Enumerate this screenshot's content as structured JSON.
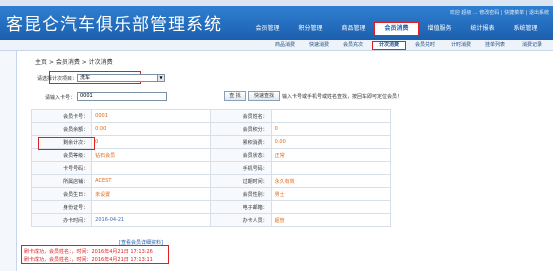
{
  "header": {
    "logo_text": "客昆仑汽车俱乐部管理系统",
    "welcome": "欢迎 超级 ... 修改密码 | 快捷菜单 | 退出系统",
    "nav": [
      {
        "label": "会员管理",
        "active": false
      },
      {
        "label": "积分管理",
        "active": false
      },
      {
        "label": "商品管理",
        "active": false
      },
      {
        "label": "会员消费",
        "active": true
      },
      {
        "label": "增值服务",
        "active": false
      },
      {
        "label": "统计报表",
        "active": false
      },
      {
        "label": "系统管理",
        "active": false
      }
    ]
  },
  "sub_nav": [
    {
      "label": "商品消费",
      "active": false
    },
    {
      "label": "快速消费",
      "active": false
    },
    {
      "label": "会员充次",
      "active": false
    },
    {
      "label": "计次消费",
      "active": true
    },
    {
      "label": "会员兑时",
      "active": false
    },
    {
      "label": "计时消费",
      "active": false
    },
    {
      "label": "挂单列表",
      "active": false
    },
    {
      "label": "消费记录",
      "active": false
    }
  ],
  "breadcrumb": "主页 > 会员消费 > 计次消费",
  "form": {
    "type_label": "请选择计次项目：",
    "type_value": "洗车",
    "card_label": "请输入卡号：",
    "card_value": "0001",
    "search_button": "查 找",
    "quick_button": "快速查找",
    "hint": "输入卡号或手机号或姓名查找，按回车即可定位会员！"
  },
  "member_info": [
    {
      "label": "会员卡号：",
      "value": "0001",
      "label2": "会员姓名：",
      "value2": ""
    },
    {
      "label": "会员余额：",
      "value": "0.00",
      "label2": "会员积分：",
      "value2": "0"
    },
    {
      "label": "剩余计次：",
      "value": "0",
      "label2": "累积消费：",
      "value2": "0.00"
    },
    {
      "label": "会员等级：",
      "value": "钻石会员",
      "label2": "会员状态：",
      "value2": "正常"
    },
    {
      "label": "卡号号码：",
      "value": "",
      "label2": "手机号码：",
      "value2": ""
    },
    {
      "label": "所属店铺：",
      "value": "ACEST",
      "label2": "过期时间：",
      "value2": "永久有效"
    },
    {
      "label": "会员生日：",
      "value": "未设置",
      "label2": "会员性别：",
      "value2": "男士"
    },
    {
      "label": "身份证号：",
      "value": "",
      "label2": "电子邮箱：",
      "value2": ""
    },
    {
      "label": "办卡时间：",
      "value": "2016-04-21",
      "label2": "办卡人员：",
      "value2": "超管"
    }
  ],
  "view_link": "[查看会员详细资料]",
  "log": [
    "刷卡成功，会员姓名：，时间：2016年4月21日 17:13:26",
    "刷卡成功，会员姓名：，时间：2016年4月21日 17:13:11"
  ]
}
